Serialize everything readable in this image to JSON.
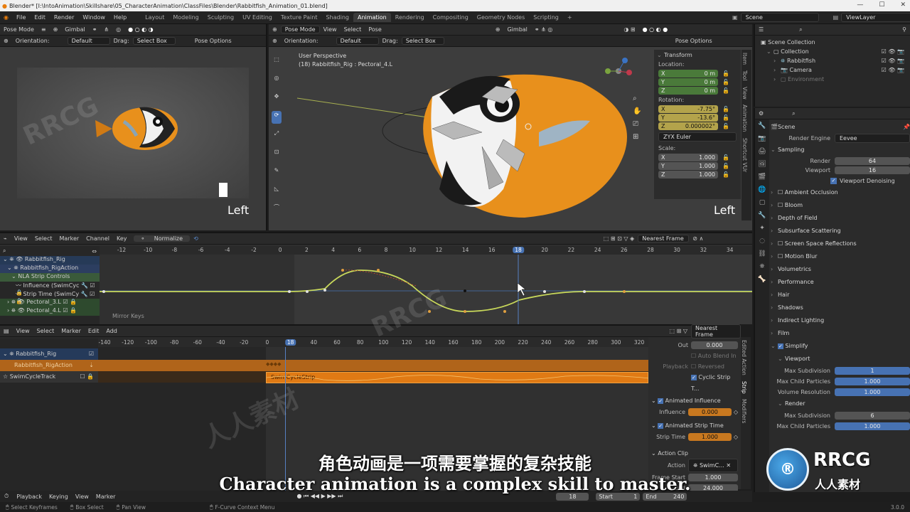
{
  "title": "Blender* [I:\\IntoAnimation\\Skillshare\\05_CharacterAnimation\\ClassFiles\\Blender\\Rabbitfish_Animation_01.blend]",
  "menu": [
    "File",
    "Edit",
    "Render",
    "Window",
    "Help"
  ],
  "workspaces": [
    "Layout",
    "Modeling",
    "Sculpting",
    "UV Editing",
    "Texture Paint",
    "Shading",
    "Animation",
    "Rendering",
    "Compositing",
    "Geometry Nodes",
    "Scripting"
  ],
  "active_workspace": "Animation",
  "scene": "Scene",
  "view_layer": "ViewLayer",
  "camera_view": {
    "mode": "Pose Mode",
    "gimbal": "Gimbal",
    "orientation_label": "Orientation:",
    "orientation": "Default",
    "drag_label": "Drag:",
    "drag": "Select Box",
    "pose_options": "Pose Options",
    "view_label": "Left"
  },
  "main_view": {
    "mode": "Pose Mode",
    "menus": [
      "View",
      "Select",
      "Pose"
    ],
    "gimbal": "Gimbal",
    "orientation_label": "Orientation:",
    "orientation": "Default",
    "drag_label": "Drag:",
    "drag": "Select Box",
    "pose_options": "Pose Options",
    "perspective": "User Perspective",
    "active": "(18) Rabbitfish_Rig : Pectoral_4.L",
    "view_label": "Left"
  },
  "transform": {
    "title": "Transform",
    "location_label": "Location:",
    "location": [
      "X",
      "Y",
      "Z"
    ],
    "location_values": [
      "0 m",
      "0 m",
      "0 m"
    ],
    "rotation_label": "Rotation:",
    "rotation": [
      "X",
      "Y",
      "Z"
    ],
    "rotation_values": [
      "-7.75°",
      "-13.6°",
      "0.000002°"
    ],
    "euler": "ZYX Euler",
    "scale_label": "Scale:",
    "scale": [
      "X",
      "Y",
      "Z"
    ],
    "scale_values": [
      "1.000",
      "1.000",
      "1.000"
    ]
  },
  "side_tabs": [
    "Item",
    "Tool",
    "View",
    "Animation",
    "Shortcut VUr"
  ],
  "outliner": {
    "root": "Scene Collection",
    "items": [
      "Collection",
      "Rabbitfish",
      "Camera",
      "Environment"
    ]
  },
  "properties": {
    "scene": "Scene",
    "render_engine_label": "Render Engine",
    "render_engine": "Eevee",
    "sampling": "Sampling",
    "render_label": "Render",
    "render_value": "64",
    "viewport_label": "Viewport",
    "viewport_value": "16",
    "viewport_denoising": "Viewport Denoising",
    "sections": [
      "Ambient Occlusion",
      "Bloom",
      "Depth of Field",
      "Subsurface Scattering",
      "Screen Space Reflections",
      "Motion Blur",
      "Volumetrics",
      "Performance",
      "Hair",
      "Shadows",
      "Indirect Lighting",
      "Film"
    ],
    "simplify": "Simplify",
    "simplify_viewport": "Viewport",
    "max_subdivision_label": "Max Subdivision",
    "max_subdivision": "1",
    "max_child_particles_label": "Max Child Particles",
    "max_child_particles": "1.000",
    "volume_resolution_label": "Volume Resolution",
    "volume_resolution": "1.000",
    "render_sub": "Render",
    "render_max_subdivision_label": "Max Subdivision",
    "render_max_subdivision": "6",
    "render_child_label": "Max Child Particles",
    "render_child": "1.000"
  },
  "graph_editor": {
    "menus": [
      "View",
      "Select",
      "Marker",
      "Channel",
      "Key"
    ],
    "normalize": "Normalize",
    "snap": "Nearest Frame",
    "ticks": [
      "-12",
      "-10",
      "-8",
      "-6",
      "-4",
      "-2",
      "0",
      "2",
      "4",
      "6",
      "8",
      "10",
      "12",
      "14",
      "16",
      "18",
      "20",
      "22",
      "24",
      "26",
      "28",
      "30",
      "32",
      "34"
    ],
    "current_frame": "18",
    "channels": [
      "Rabbitfish_Rig",
      "Rabbitfish_RigAction",
      "NLA Strip Controls",
      "Influence (SwimCyc",
      "Strip Time (SwimCy",
      "Pectoral_3.L",
      "Pectoral_4.L"
    ],
    "footer": "Mirror Keys"
  },
  "nla_editor": {
    "menus": [
      "View",
      "Select",
      "Marker",
      "Edit",
      "Add"
    ],
    "snap": "Nearest Frame",
    "ticks": [
      "-140",
      "-120",
      "-100",
      "-80",
      "-60",
      "-40",
      "-20",
      "0",
      "18",
      "40",
      "60",
      "80",
      "100",
      "120",
      "140",
      "160",
      "180",
      "200",
      "220",
      "240",
      "260",
      "280",
      "300",
      "320"
    ],
    "tracks": [
      "Rabbitfish_Rig",
      "Rabbitfish_RigAction",
      "SwimCycleTrack"
    ],
    "strip_name": "SwimCycleStrip"
  },
  "strip_panel": {
    "out_label": "Out",
    "out_value": "0.000",
    "auto_blend": "Auto Blend In",
    "playback_label": "Playback",
    "reversed": "Reversed",
    "cyclic": "Cyclic Strip T...",
    "animated_influence": "Animated Influence",
    "influence_label": "Influence",
    "influence_value": "0.000",
    "animated_strip_time": "Animated Strip Time",
    "strip_time_label": "Strip Time",
    "strip_time_value": "1.000",
    "action_clip": "Action Clip",
    "action_label": "Action",
    "action_value": "SwimC...",
    "frame_start_label": "Frame Start",
    "frame_start_value": "1.000",
    "end_label": "End",
    "end_value": "24.000",
    "tabs": [
      "Edited Action",
      "Strip",
      "Modifiers"
    ]
  },
  "timeline": {
    "menus": [
      "Playback",
      "Keying",
      "View",
      "Marker"
    ],
    "current": "18",
    "start_label": "Start",
    "start": "1",
    "end_label": "End",
    "end": "240"
  },
  "status_bar": [
    "Select Keyframes",
    "Box Select",
    "Pan View",
    "F-Curve Context Menu"
  ],
  "version": "3.0.0",
  "subtitle_cn": "角色动画是一项需要掌握的复杂技能",
  "subtitle_en": "Character animation is a complex skill to master.",
  "watermark": "RRCG",
  "watermark_cn": "人人素材",
  "colors": {
    "accent": "#4772b3",
    "nla_orange": "#e07a14",
    "curve": "#c8d85a",
    "fish_orange": "#e8901c"
  }
}
